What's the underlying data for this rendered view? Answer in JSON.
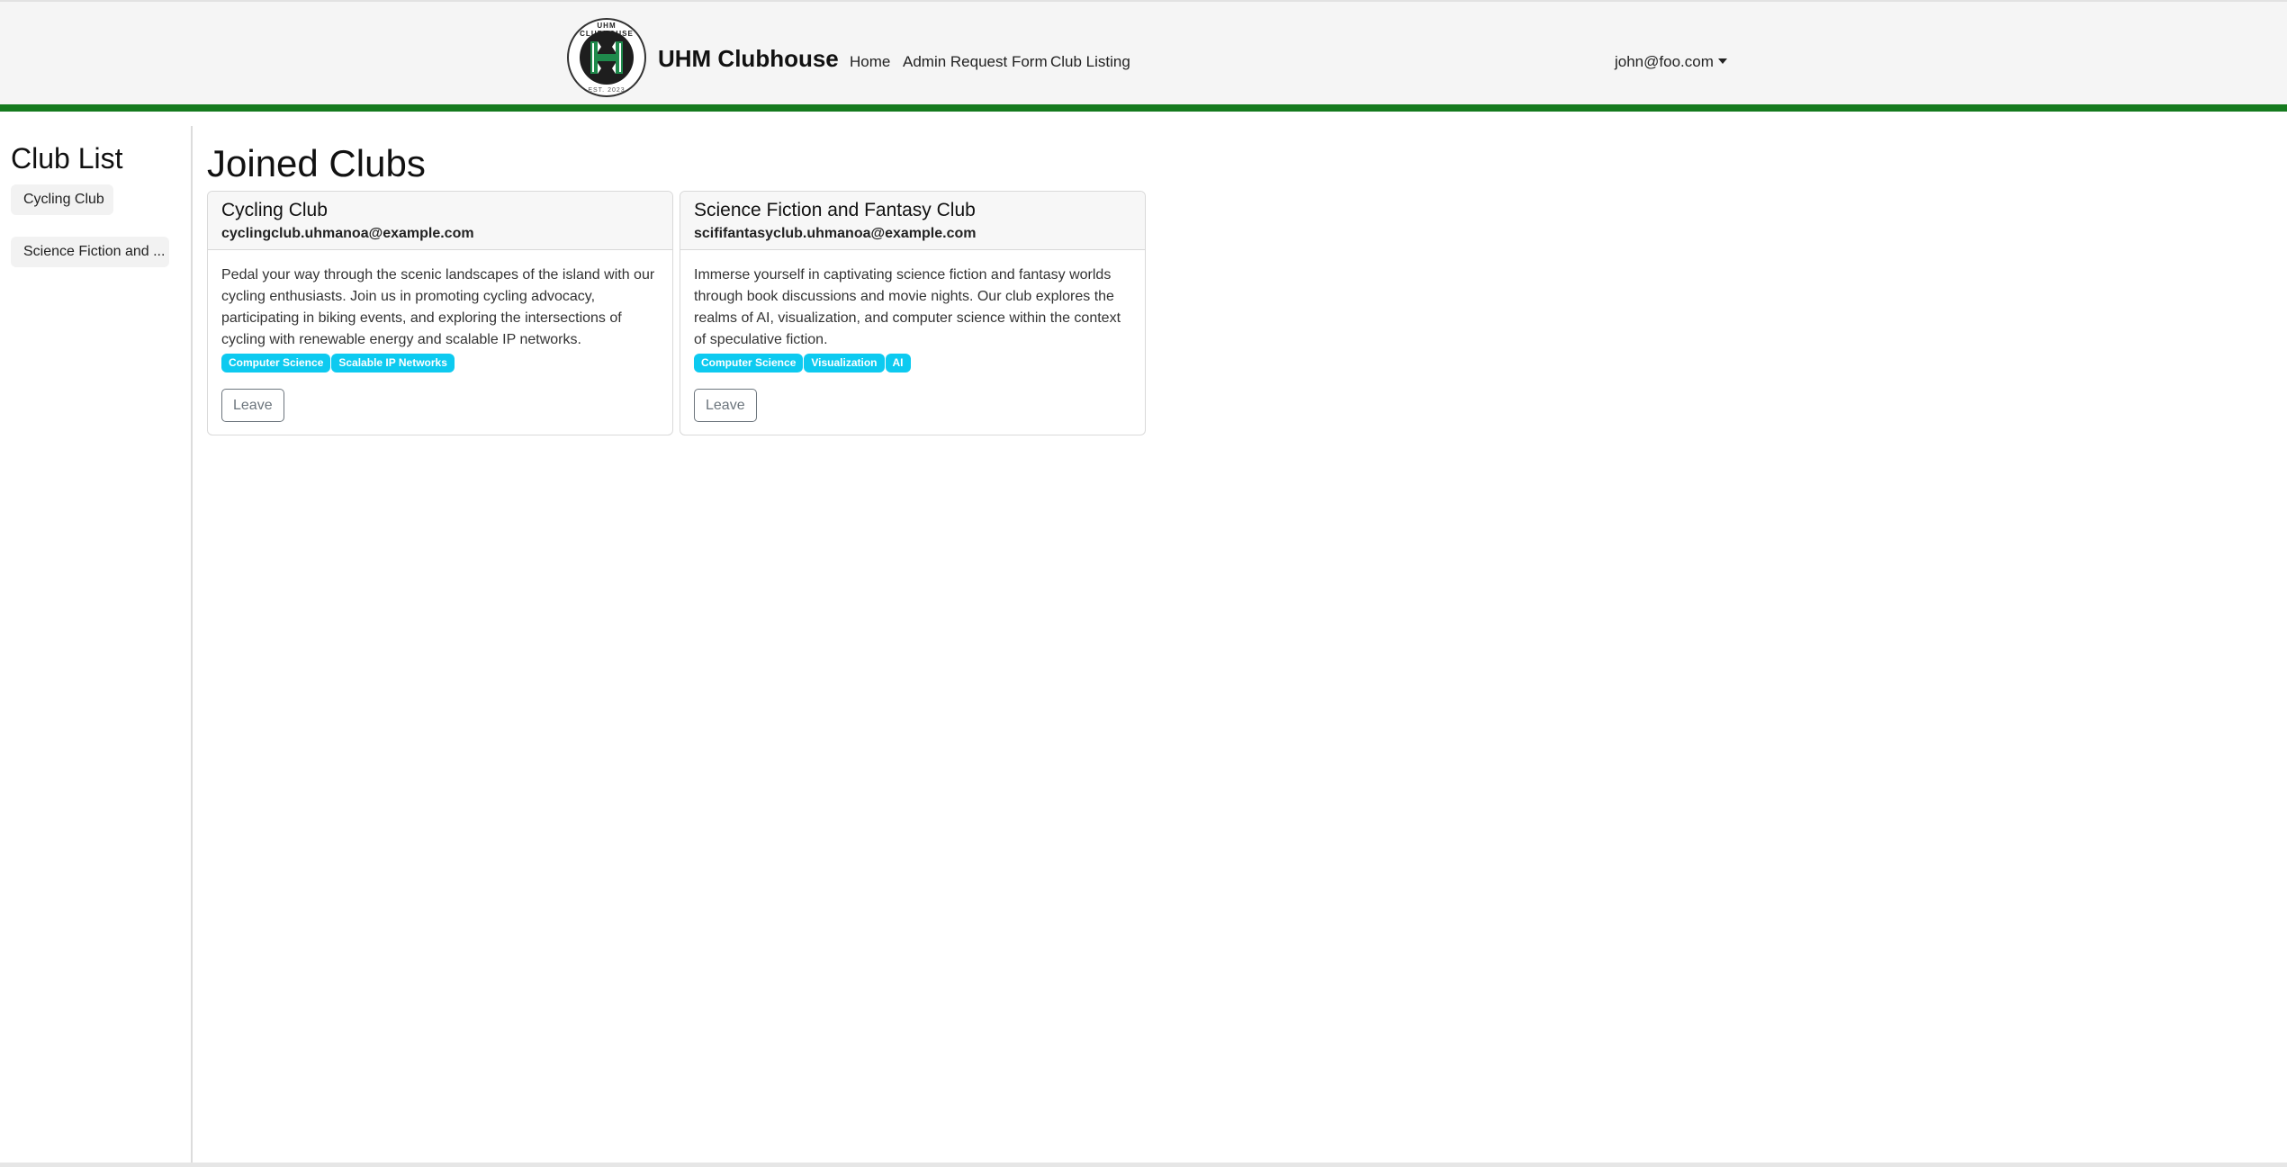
{
  "navbar": {
    "logo_top_text": "UHM CLUBHOUSE",
    "logo_bottom_text": "EST. 2023",
    "logo_letter": "H",
    "brand": "UHM Clubhouse",
    "links": [
      {
        "label": "Home"
      },
      {
        "label": "Admin Request Form"
      },
      {
        "label": "Club Listing"
      }
    ],
    "user": "john@foo.com",
    "accent_color": "#157a1e"
  },
  "sidebar": {
    "title": "Club List",
    "items": [
      {
        "label": "Cycling Club"
      },
      {
        "label": "Science Fiction and ..."
      }
    ]
  },
  "main": {
    "title": "Joined Clubs",
    "cards": [
      {
        "name": "Cycling Club",
        "email": "cyclingclub.uhmanoa@example.com",
        "description": "Pedal your way through the scenic landscapes of the island with our cycling enthusiasts. Join us in promoting cycling advocacy, participating in biking events, and exploring the intersections of cycling with renewable energy and scalable IP networks.",
        "tags": [
          "Computer Science",
          "Scalable IP Networks"
        ],
        "button": "Leave"
      },
      {
        "name": "Science Fiction and Fantasy Club",
        "email": "scififantasyclub.uhmanoa@example.com",
        "description": "Immerse yourself in captivating science fiction and fantasy worlds through book discussions and movie nights. Our club explores the realms of AI, visualization, and computer science within the context of speculative fiction.",
        "tags": [
          "Computer Science",
          "Visualization",
          "AI"
        ],
        "button": "Leave"
      }
    ],
    "tag_color": "#0dcaf0"
  }
}
